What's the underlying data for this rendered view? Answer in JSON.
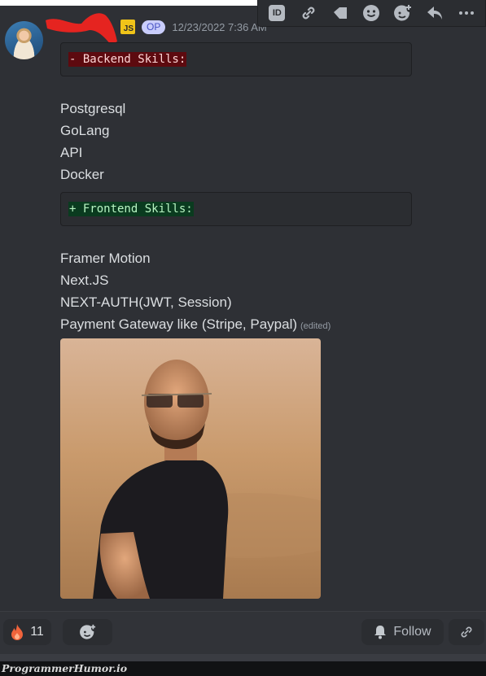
{
  "message": {
    "author_badges": {
      "language_badge": "JS",
      "op_badge": "OP"
    },
    "timestamp": "12/23/2022 7:36 AM",
    "toolbar": {
      "id_label": "ID",
      "icons": [
        "id-icon",
        "link-icon",
        "tag-icon",
        "emoji-icon",
        "add-reaction-icon",
        "reply-icon",
        "more-icon"
      ]
    },
    "backend_block": "- Backend Skills:",
    "backend_items": [
      "Postgresql",
      "GoLang",
      "API",
      "Docker"
    ],
    "frontend_block": "+ Frontend Skills:",
    "frontend_items": [
      "Framer Motion",
      "Next.JS",
      "NEXT-AUTH(JWT, Session)",
      "Payment Gateway like (Stripe, Paypal)"
    ],
    "edited_label": "(edited)",
    "attachment": {
      "description": "photo of a bald man with sunglasses and black t-shirt in a desert"
    }
  },
  "footer": {
    "reaction": {
      "emoji": "fire-icon",
      "count": "11"
    },
    "add_reaction": "add-reaction-icon",
    "follow_label": "Follow",
    "share": "link-icon"
  },
  "watermark": "ProgrammerHumor.io",
  "colors": {
    "background": "#2e3035",
    "text": "#dbdee1",
    "muted": "#949ba4",
    "diff_removed_bg": "#5d0a0f",
    "diff_added_bg": "#0a3b1f",
    "js_badge": "#f0c419",
    "op_badge": "#c9cdfb",
    "fire": "#f0643c"
  }
}
